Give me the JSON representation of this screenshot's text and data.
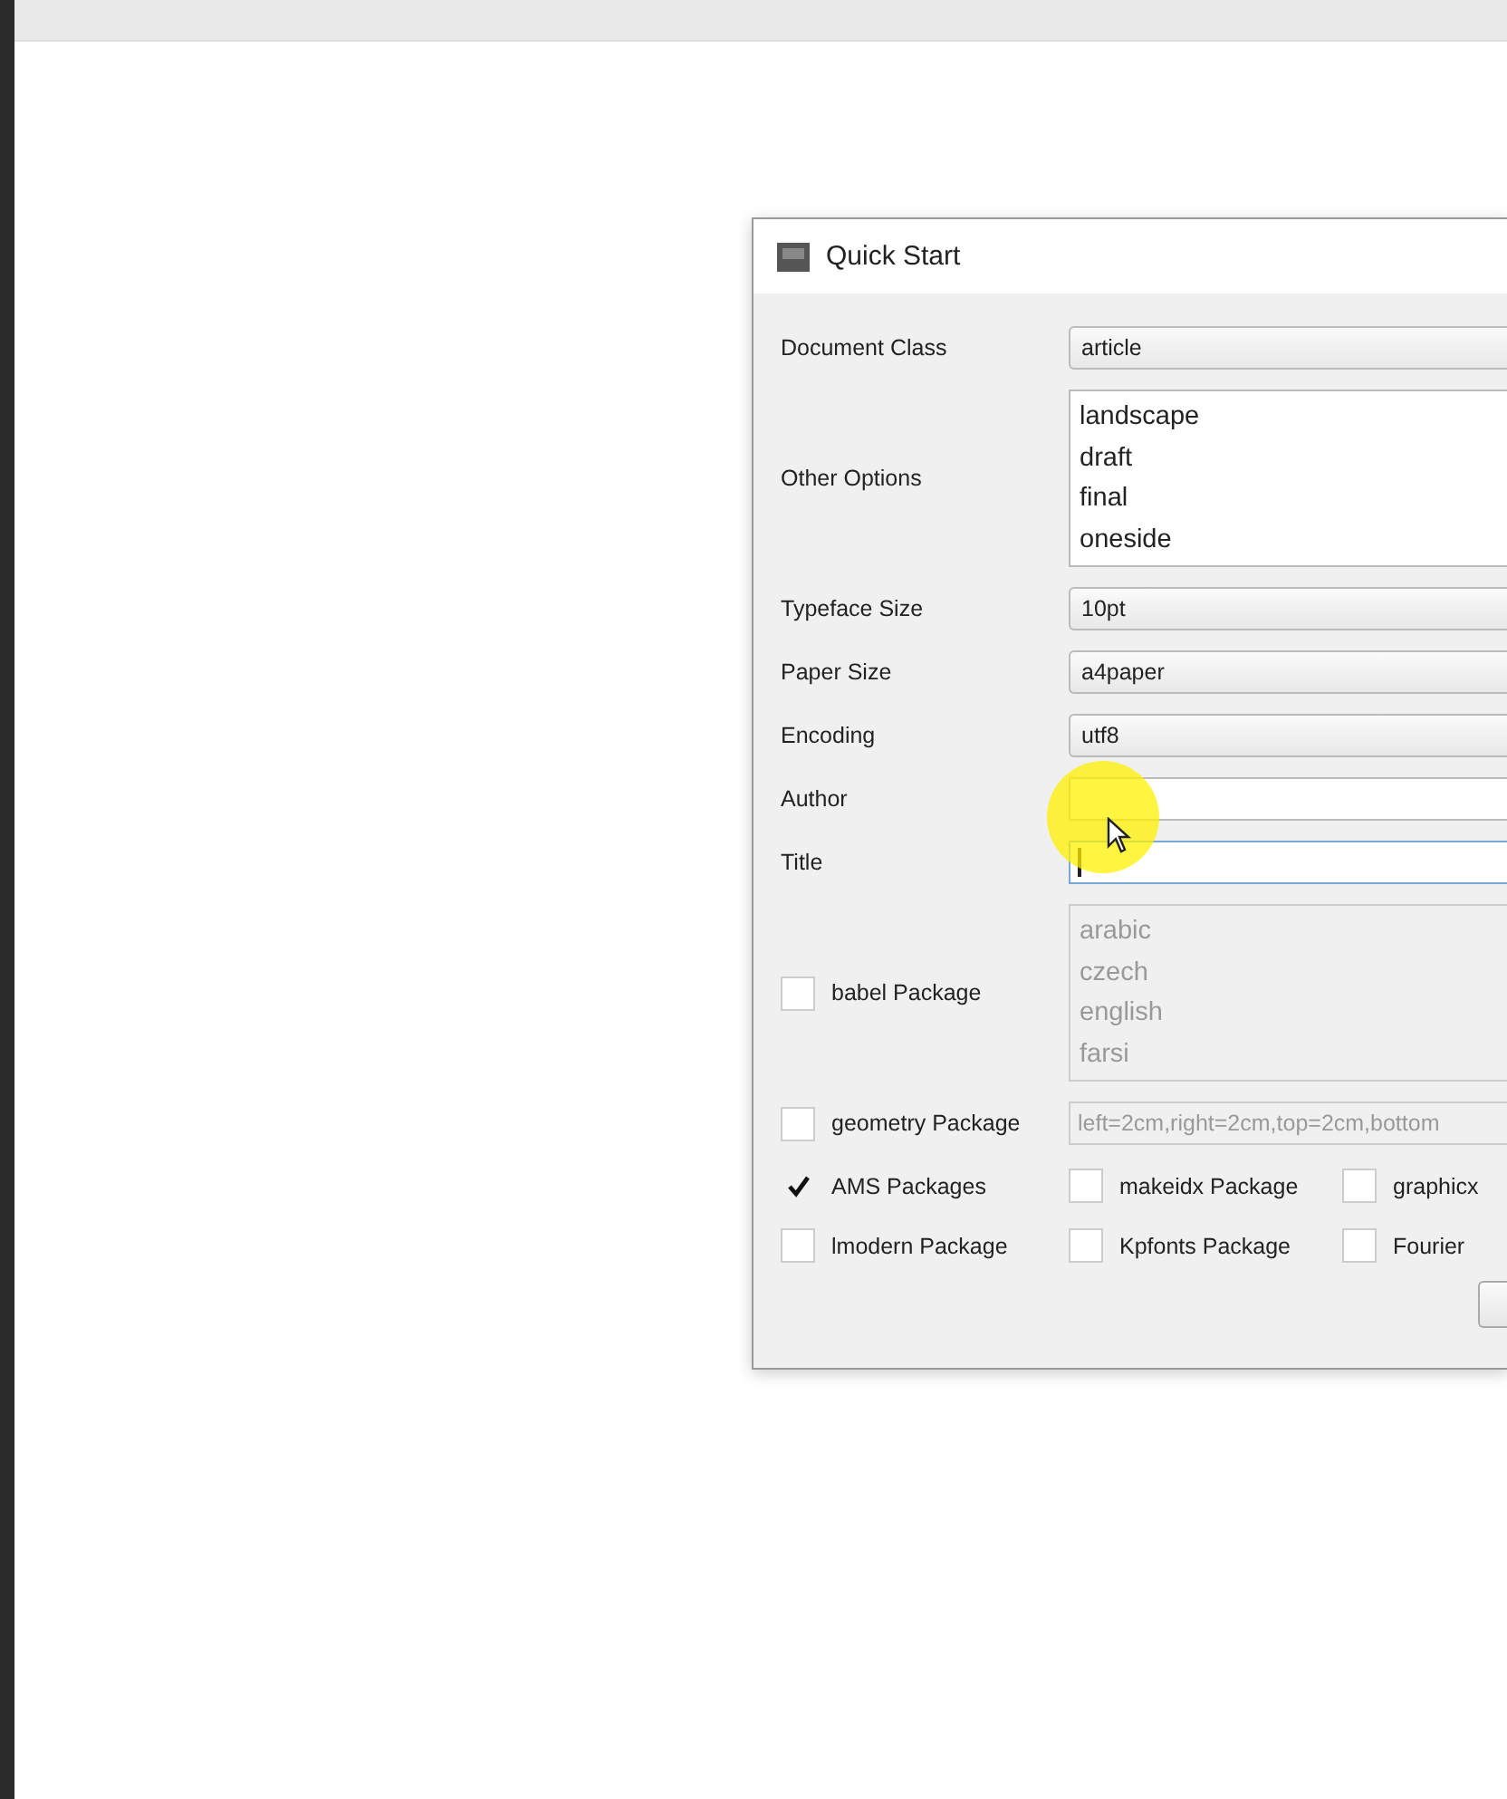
{
  "window": {
    "title": "Quick Start"
  },
  "fields": [
    {
      "kind": "combo",
      "label": "Document Class",
      "value": "article"
    },
    {
      "kind": "list",
      "label": "Other Options",
      "items": [
        "landscape",
        "draft",
        "final",
        "oneside"
      ]
    },
    {
      "kind": "combo",
      "label": "Typeface Size",
      "value": "10pt"
    },
    {
      "kind": "combo",
      "label": "Paper Size",
      "value": "a4paper"
    },
    {
      "kind": "combo",
      "label": "Encoding",
      "value": "utf8"
    },
    {
      "kind": "text",
      "label": "Author",
      "focused": false
    },
    {
      "kind": "text",
      "label": "Title",
      "focused": true
    },
    {
      "kind": "checklist",
      "label": "babel Package",
      "checked": false,
      "disabled": true,
      "items": [
        "arabic",
        "czech",
        "english",
        "farsi"
      ]
    },
    {
      "kind": "checkfield",
      "label": "geometry Package",
      "checked": false,
      "disabled": true,
      "value": "left=2cm,right=2cm,top=2cm,bottom"
    }
  ],
  "packages": [
    {
      "label": "AMS Packages",
      "checked": true
    },
    {
      "label": "makeidx Package",
      "checked": false
    },
    {
      "label": "graphicx",
      "checked": false
    },
    {
      "label": "lmodern Package",
      "checked": false
    },
    {
      "label": "Kpfonts Package",
      "checked": false
    },
    {
      "label": "Fourier",
      "checked": false
    }
  ]
}
